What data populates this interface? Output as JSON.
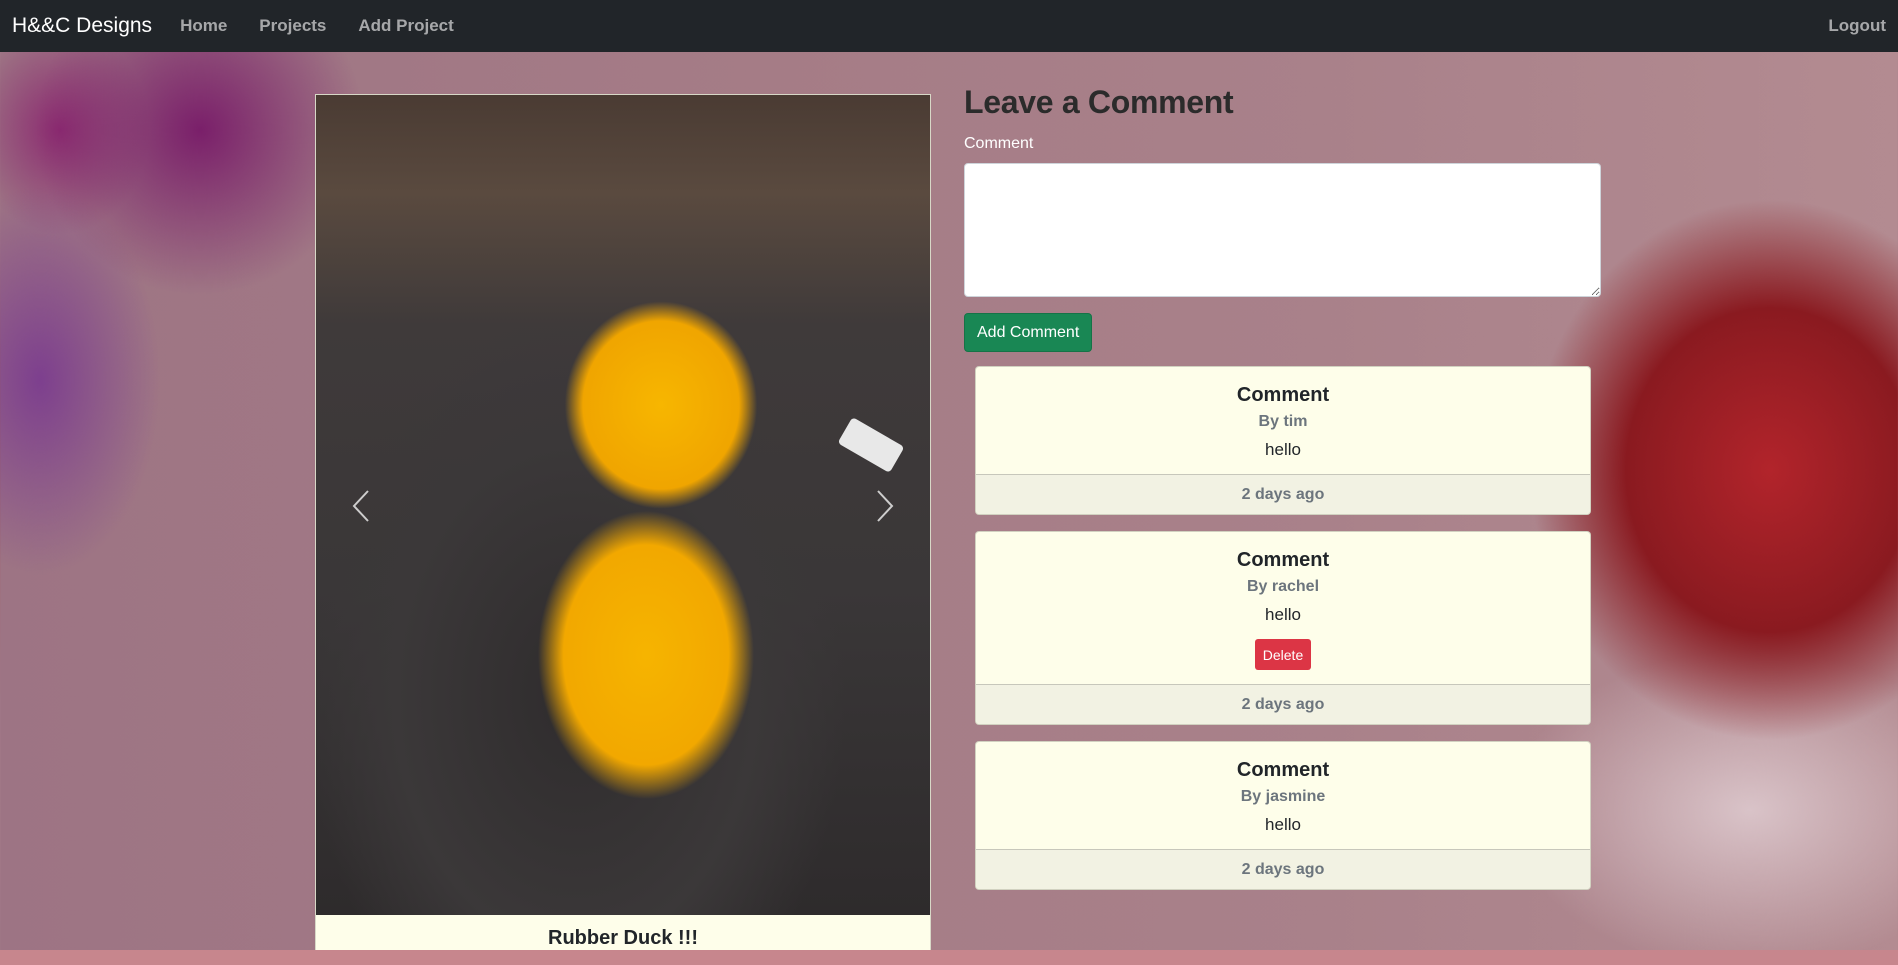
{
  "navbar": {
    "brand": "H&&C Designs",
    "links": [
      "Home",
      "Projects",
      "Add Project"
    ],
    "logout": "Logout"
  },
  "project": {
    "title": "Rubber Duck !!!",
    "carousel": {
      "prev_icon": "chevron-left-icon",
      "next_icon": "chevron-right-icon"
    }
  },
  "comment_form": {
    "heading": "Leave a Comment",
    "label": "Comment",
    "textarea_value": "",
    "submit_label": "Add Comment"
  },
  "comments": [
    {
      "title": "Comment",
      "author": "By tim",
      "text": "hello",
      "time": "2 days ago",
      "delete_label": ""
    },
    {
      "title": "Comment",
      "author": "By rachel",
      "text": "hello",
      "time": "2 days ago",
      "delete_label": "Delete"
    },
    {
      "title": "Comment",
      "author": "By jasmine",
      "text": "hello",
      "time": "2 days ago",
      "delete_label": ""
    }
  ],
  "colors": {
    "navbar": "#212529",
    "success": "#198754",
    "danger": "#dc3545",
    "card": "#fefeea"
  }
}
